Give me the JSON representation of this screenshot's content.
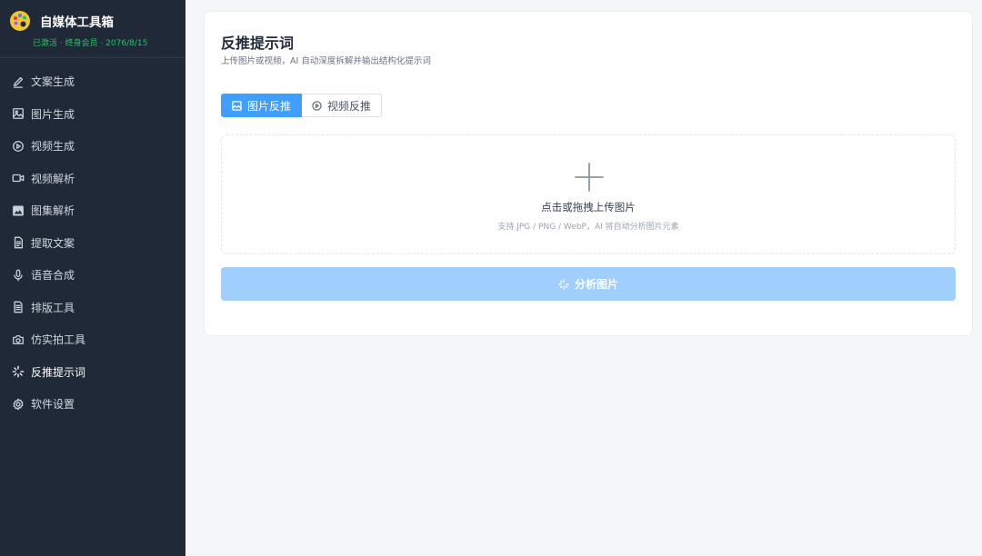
{
  "brand": {
    "title": "自媒体工具箱",
    "status": "已激活 · 终身会员 · 2076/8/15",
    "logo_icon": "palette-icon"
  },
  "sidebar": {
    "items": [
      {
        "label": "文案生成",
        "icon": "pen-icon"
      },
      {
        "label": "图片生成",
        "icon": "image-icon"
      },
      {
        "label": "视频生成",
        "icon": "play-circle-icon"
      },
      {
        "label": "视频解析",
        "icon": "video-camera-icon"
      },
      {
        "label": "图集解析",
        "icon": "picture-icon"
      },
      {
        "label": "提取文案",
        "icon": "document-icon"
      },
      {
        "label": "语音合成",
        "icon": "microphone-icon"
      },
      {
        "label": "排版工具",
        "icon": "document-lines-icon"
      },
      {
        "label": "仿实拍工具",
        "icon": "camera-icon"
      },
      {
        "label": "反推提示词",
        "icon": "sparkle-icon"
      },
      {
        "label": "软件设置",
        "icon": "gear-icon"
      }
    ],
    "active_index": 9
  },
  "main": {
    "title": "反推提示词",
    "subtitle": "上传图片或视频，AI 自动深度拆解并输出结构化提示词",
    "tabs": [
      {
        "label": "图片反推",
        "icon": "image-icon",
        "active": true
      },
      {
        "label": "视频反推",
        "icon": "play-circle-icon",
        "active": false
      }
    ],
    "upload": {
      "main_text": "点击或拖拽上传图片",
      "hint_text": "支持 JPG / PNG / WebP，AI 将自动分析图片元素",
      "icon": "plus-icon"
    },
    "analyze_button": {
      "label": "分析图片",
      "icon": "sparkle-icon",
      "disabled": true
    }
  },
  "colors": {
    "sidebar_bg": "#1f2937",
    "accent": "#409eff",
    "accent_disabled": "#a0cfff",
    "status_green": "#22c55e"
  }
}
